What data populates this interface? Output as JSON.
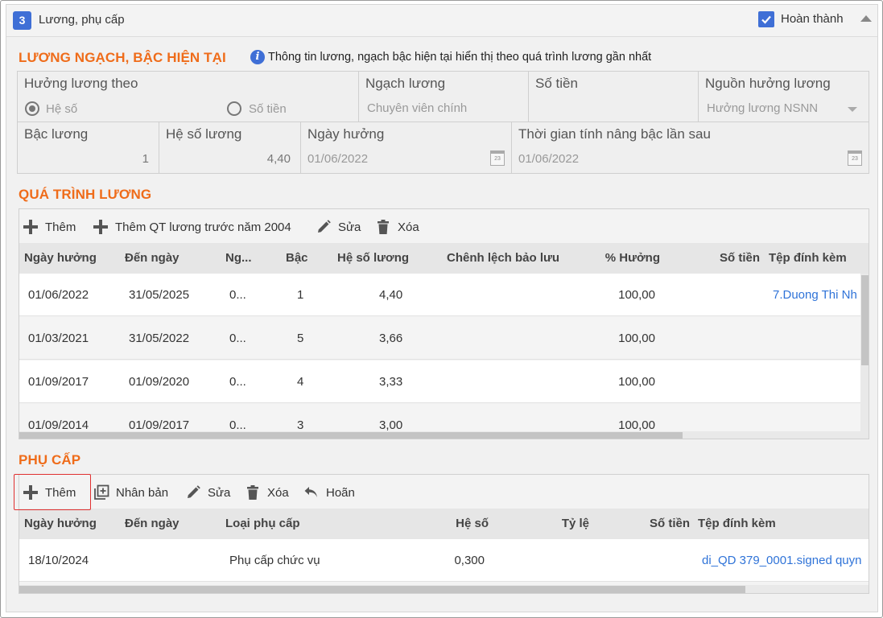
{
  "header": {
    "step_number": "3",
    "title": "Lương, phụ cấp",
    "done_label": "Hoàn thành",
    "done_checked": true
  },
  "current_salary": {
    "section_title": "LƯƠNG NGẠCH, BẬC HIỆN TẠI",
    "info_text": "Thông tin lương, ngạch bậc hiện tại hiển thị theo quá trình lương gần nhất",
    "salary_basis_label": "Hưởng lương theo",
    "option_coefficient": "Hệ số",
    "option_amount": "Số tiền",
    "selected_option": "Hệ số",
    "grade_label": "Ngạch lương",
    "grade_value": "Chuyên viên chính",
    "amount_label": "Số tiền",
    "amount_value": "",
    "source_label": "Nguồn hưởng lương",
    "source_value": "Hưởng lương NSNN",
    "step_label": "Bậc lương",
    "step_value": "1",
    "coef_label": "Hệ số lương",
    "coef_value": "4,40",
    "start_label": "Ngày hưởng",
    "start_value": "01/06/2022",
    "next_label": "Thời gian tính nâng bậc lần sau",
    "next_value": "01/06/2022"
  },
  "salary_history": {
    "section_title": "QUÁ TRÌNH LƯƠNG",
    "toolbar": {
      "add": "Thêm",
      "add_before_2004": "Thêm QT lương trước năm 2004",
      "edit": "Sửa",
      "delete": "Xóa"
    },
    "columns": [
      "Ngày hưởng",
      "Đến ngày",
      "Ng...",
      "Bậc",
      "Hệ số lương",
      "Chênh lệch bảo lưu",
      "% Hưởng",
      "Số tiền",
      "Tệp đính kèm"
    ],
    "rows": [
      [
        "01/06/2022",
        "31/05/2025",
        "0...",
        "1",
        "4,40",
        "",
        "100,00",
        "",
        "7.Duong Thi Nh"
      ],
      [
        "01/03/2021",
        "31/05/2022",
        "0...",
        "5",
        "3,66",
        "",
        "100,00",
        "",
        ""
      ],
      [
        "01/09/2017",
        "01/09/2020",
        "0...",
        "4",
        "3,33",
        "",
        "100,00",
        "",
        ""
      ],
      [
        "01/09/2014",
        "01/09/2017",
        "0...",
        "3",
        "3,00",
        "",
        "100,00",
        "",
        ""
      ]
    ]
  },
  "allowance": {
    "section_title": "PHỤ CẤP",
    "toolbar": {
      "add": "Thêm",
      "duplicate": "Nhân bản",
      "edit": "Sửa",
      "delete": "Xóa",
      "undo": "Hoãn"
    },
    "columns": [
      "Ngày hưởng",
      "Đến ngày",
      "Loại phụ cấp",
      "Hệ số",
      "Tỷ lệ",
      "Số tiền",
      "Tệp đính kèm"
    ],
    "rows": [
      [
        "18/10/2024",
        "",
        "Phụ cấp chức vụ",
        "0,300",
        "",
        "",
        "di_QD 379_0001.signed quyn"
      ]
    ]
  },
  "colors": {
    "accent": "#ef6c1a",
    "primary": "#3f6fd6",
    "link": "#2f73d8",
    "highlight": "#e03030"
  }
}
